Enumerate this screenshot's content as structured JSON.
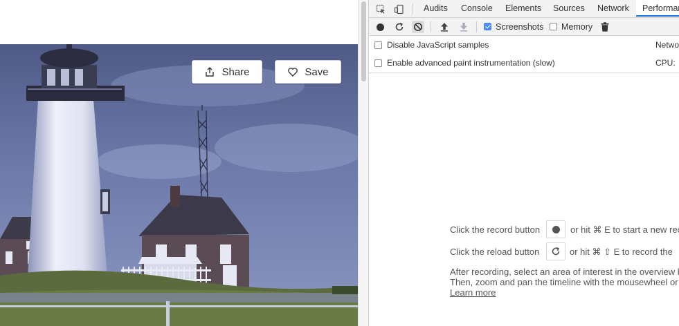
{
  "hero": {
    "share_label": "Share",
    "save_label": "Save"
  },
  "devtools": {
    "tabs": [
      {
        "label": "Audits"
      },
      {
        "label": "Console"
      },
      {
        "label": "Elements"
      },
      {
        "label": "Sources"
      },
      {
        "label": "Network"
      },
      {
        "label": "Performance",
        "active": true
      }
    ],
    "toolbar": {
      "screenshots_label": "Screenshots",
      "screenshots_checked": true,
      "memory_label": "Memory",
      "memory_checked": false
    },
    "settings": {
      "disable_js_label": "Disable JavaScript samples",
      "advanced_paint_label": "Enable advanced paint instrumentation (slow)",
      "network_label": "Netwo",
      "cpu_label": "CPU:"
    },
    "landing": {
      "record_prefix": "Click the record button",
      "record_suffix": "or hit ⌘ E to start a new reco",
      "reload_prefix": "Click the reload button",
      "reload_suffix": "or hit ⌘ ⇧ E to record the",
      "after_line1": "After recording, select an area of interest in the overview b",
      "after_line2": "Then, zoom and pan the timeline with the mousewheel or",
      "learn_more": "Learn more"
    }
  },
  "colors": {
    "accent_blue": "#1a73e8",
    "checkbox_blue": "#4a8af4",
    "sky": "#5d6a9a",
    "grass": "#5b6b3e"
  }
}
